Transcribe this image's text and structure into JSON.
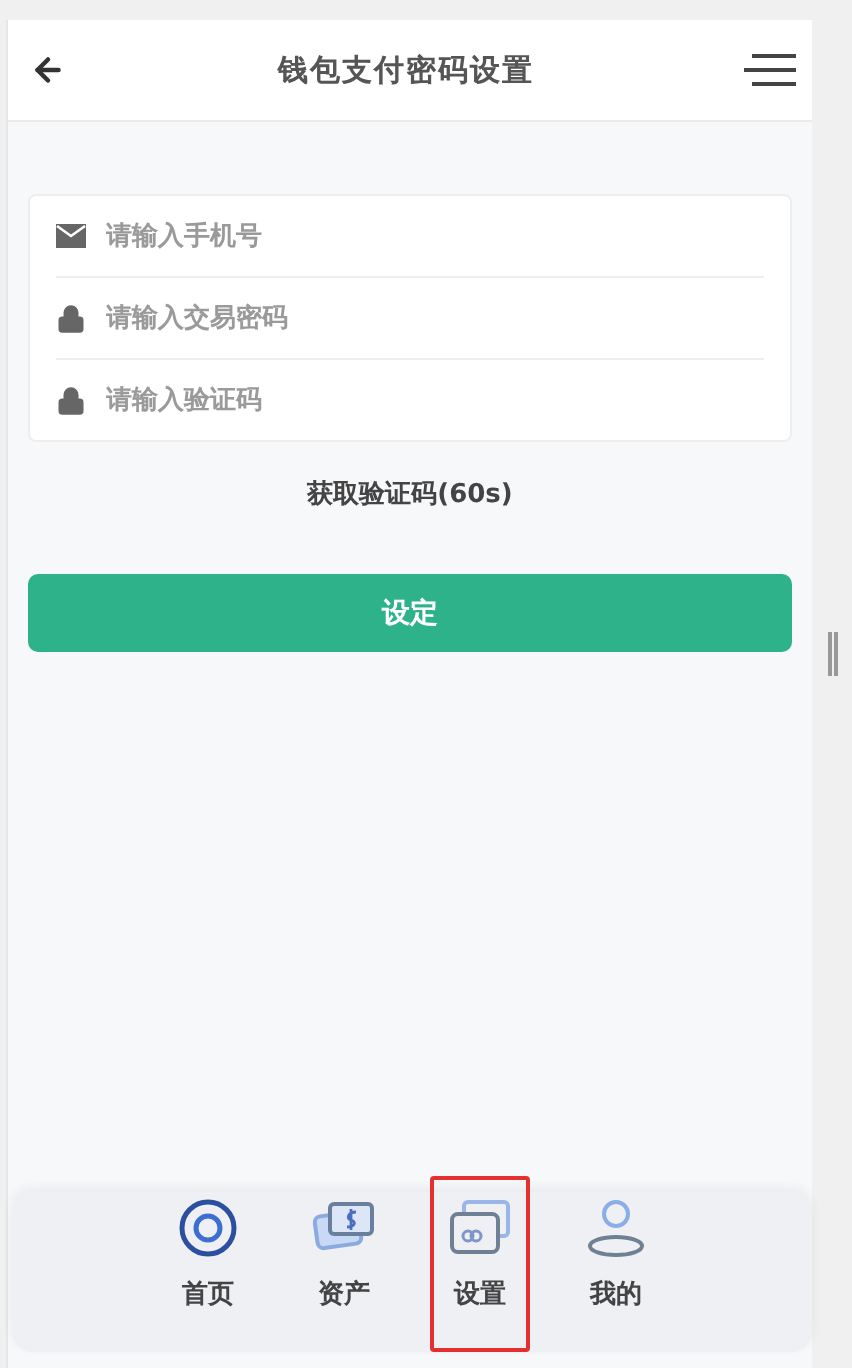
{
  "header": {
    "title": "钱包支付密码设置"
  },
  "fields": [
    {
      "kind": "phone",
      "placeholder": "请输入手机号"
    },
    {
      "kind": "password",
      "placeholder": "请输入交易密码"
    },
    {
      "kind": "code",
      "placeholder": "请输入验证码"
    }
  ],
  "get_code": "获取验证码(60s)",
  "submit": "设定",
  "nav": [
    {
      "kind": "home",
      "label": "首页",
      "highlighted": false
    },
    {
      "kind": "assets",
      "label": "资产",
      "highlighted": false
    },
    {
      "kind": "cards",
      "label": "设置",
      "highlighted": true
    },
    {
      "kind": "profile",
      "label": "我的",
      "highlighted": false
    }
  ]
}
